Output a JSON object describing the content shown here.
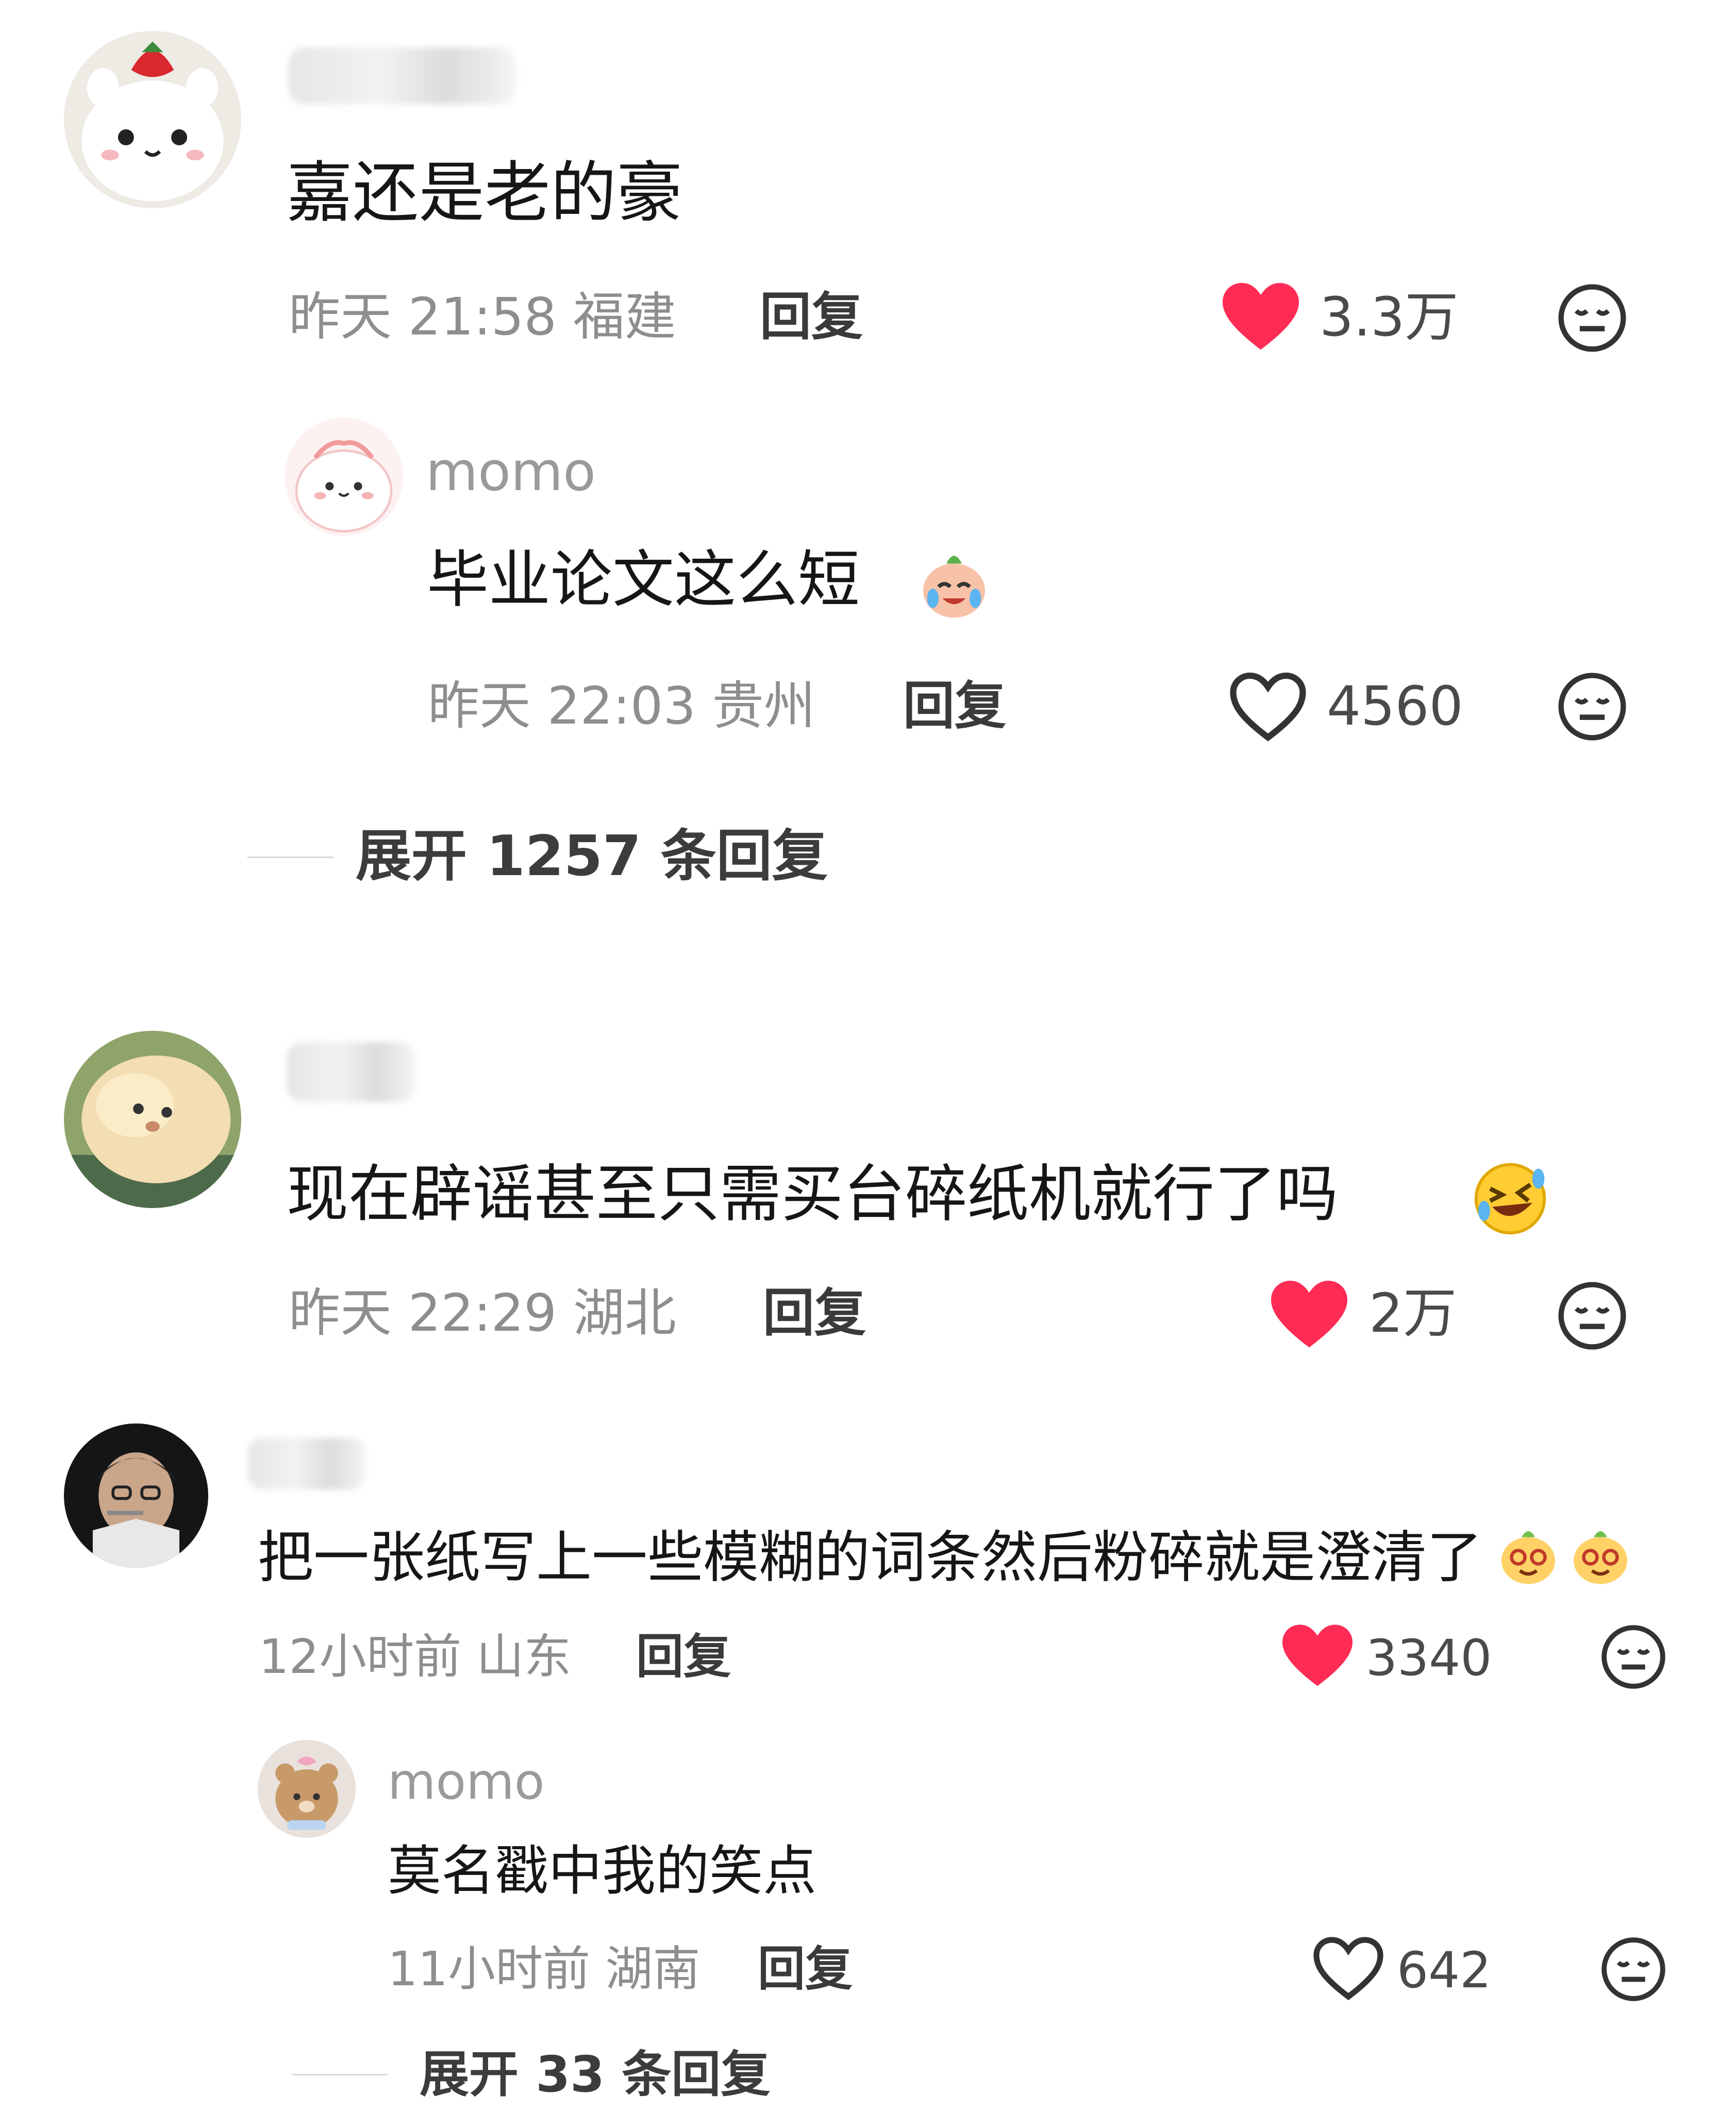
{
  "comments": [
    {
      "username": "",
      "text": "嘉还是老的豪",
      "time": "昨天 21:58",
      "location": "福建",
      "reply_label": "回复",
      "likes": "3.3万",
      "liked": true,
      "replies": [
        {
          "username": "momo",
          "text": "毕业论文这么短",
          "time": "昨天 22:03",
          "location": "贵州",
          "reply_label": "回复",
          "likes": "4560",
          "liked": false,
          "emoji": "crying-laughing-sticker"
        }
      ],
      "expand_label": "展开 1257 条回复"
    },
    {
      "username": "",
      "text": "现在辟谣甚至只需买台碎纸机就行了吗",
      "emoji": "rolling-laughing-emoji",
      "time": "昨天 22:29",
      "location": "湖北",
      "reply_label": "回复",
      "likes": "2万",
      "liked": true
    },
    {
      "username": "",
      "text": "把一张纸写上一些模糊的词条然后粉碎就是澄清了",
      "emoji": "dizzy-face-sticker",
      "time": "12小时前",
      "location": "山东",
      "reply_label": "回复",
      "likes": "3340",
      "liked": true,
      "replies": [
        {
          "username": "momo",
          "text": "莫名戳中我的笑点",
          "time": "11小时前",
          "location": "湖南",
          "reply_label": "回复",
          "likes": "642",
          "liked": false
        }
      ],
      "expand_label": "展开 33 条回复"
    }
  ],
  "colors": {
    "like_red": "#fe2c55",
    "muted_text": "#8e8e8e",
    "main_text": "#161616"
  }
}
